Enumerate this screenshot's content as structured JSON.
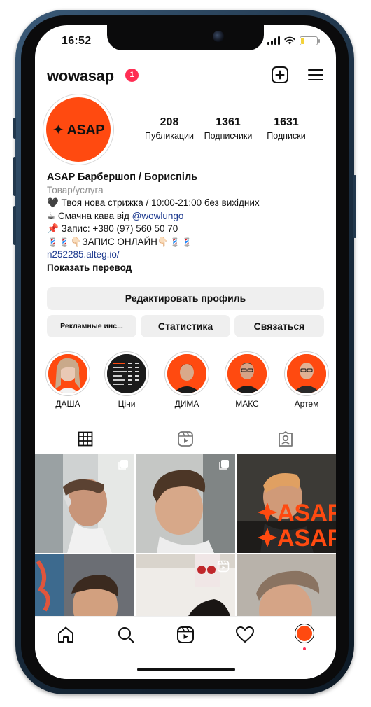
{
  "status_bar": {
    "time": "16:52"
  },
  "header": {
    "username": "wowasap",
    "notification_count": "1"
  },
  "profile": {
    "avatar_text": "✦ ASAP",
    "stats": [
      {
        "value": "208",
        "label": "Публикации"
      },
      {
        "value": "1361",
        "label": "Подписчики"
      },
      {
        "value": "1631",
        "label": "Подписки"
      }
    ]
  },
  "bio": {
    "name": "ASAP Барбершоп / Бориспіль",
    "category": "Товар/услуга",
    "line1": "🖤 Твоя нова стрижка / 10:00-21:00 без вихідних",
    "line2_prefix": "☕ Смачна кава від ",
    "line2_mention": "@wowlungo",
    "line3": "📌 Запис: +380 (97) 560 50 70",
    "line4": "💈💈👇🏻ЗАПИС ОНЛАЙН👇🏻💈💈",
    "link": "n252285.alteg.io/",
    "translate": "Показать перевод"
  },
  "buttons": {
    "edit_profile": "Редактировать профиль",
    "ads": "Рекламные инс...",
    "stats": "Статистика",
    "contact": "Связаться"
  },
  "highlights": [
    {
      "label": "ДАША"
    },
    {
      "label": "Ціни"
    },
    {
      "label": "ДИМА"
    },
    {
      "label": "МАКС"
    },
    {
      "label": "Артем"
    }
  ],
  "colors": {
    "brand_orange": "#ff4a10",
    "badge_red": "#ff2e54",
    "link_blue": "#1d3a8f"
  },
  "icons": [
    "plus-square-icon",
    "menu-icon",
    "grid-icon",
    "reels-icon",
    "tagged-icon",
    "home-icon",
    "search-icon",
    "reels-nav-icon",
    "heart-icon",
    "profile-avatar-icon",
    "multi-post-icon"
  ],
  "posts_overlay_text": {
    "asap_1": "ASAP",
    "asap_2": "ASAP"
  }
}
